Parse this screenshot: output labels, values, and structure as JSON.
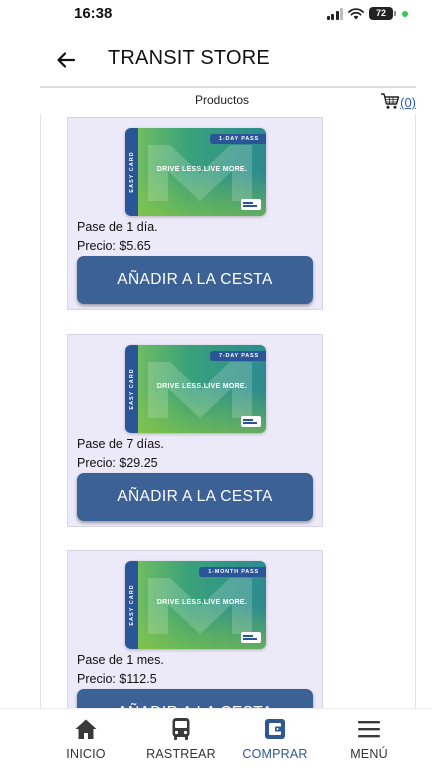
{
  "status_bar": {
    "time": "16:38",
    "battery": "72"
  },
  "header": {
    "title": "TRANSIT STORE"
  },
  "subheader": {
    "title": "Productos",
    "cart_count": "(0)"
  },
  "card_art": {
    "side_text": "EASY CARD",
    "slogan": "DRIVE LESS.LIVE MORE."
  },
  "products": [
    {
      "pass_label": "1-DAY PASS",
      "name": "Pase de 1 día.",
      "price": "Precio: $5.65",
      "button": "AÑADIR A LA CESTA"
    },
    {
      "pass_label": "7-DAY PASS",
      "name": "Pase de 7 días.",
      "price": "Precio: $29.25",
      "button": "AÑADIR A LA CESTA"
    },
    {
      "pass_label": "1-MONTH PASS",
      "name": "Pase de 1 mes.",
      "price": "Precio: $112.5",
      "button": "AÑADIR A LA CESTA"
    }
  ],
  "bottom_nav": [
    {
      "label": "INICIO",
      "icon": "home-icon",
      "active": false
    },
    {
      "label": "RASTREAR",
      "icon": "bus-icon",
      "active": false
    },
    {
      "label": "COMPRAR",
      "icon": "wallet-icon",
      "active": true
    },
    {
      "label": "MENÚ",
      "icon": "menu-icon",
      "active": false
    }
  ],
  "colors": {
    "accent": "#3b6195",
    "active_nav": "#2f5891",
    "card_bg": "#ece9f9",
    "link": "#2a5bc4"
  }
}
